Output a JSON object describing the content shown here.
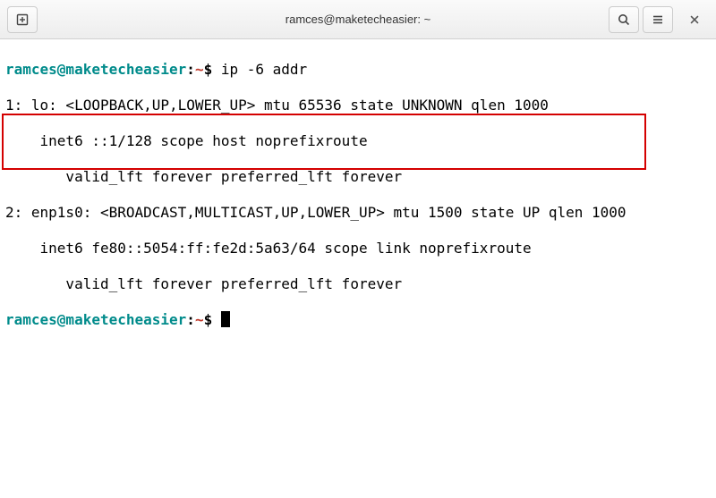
{
  "titlebar": {
    "title": "ramces@maketecheasier: ~"
  },
  "prompt": {
    "user": "ramces@maketecheasier",
    "sep": ":",
    "path": "~",
    "dollar": "$"
  },
  "lines": {
    "cmd1": "ip -6 addr",
    "out1": "1: lo: <LOOPBACK,UP,LOWER_UP> mtu 65536 state UNKNOWN qlen 1000",
    "out2": "    inet6 ::1/128 scope host noprefixroute",
    "out3": "       valid_lft forever preferred_lft forever",
    "out4": "2: enp1s0: <BROADCAST,MULTICAST,UP,LOWER_UP> mtu 1500 state UP qlen 1000",
    "out5": "    inet6 fe80::5054:ff:fe2d:5a63/64 scope link noprefixroute",
    "out6": "       valid_lft forever preferred_lft forever"
  },
  "icons": {
    "newtab": "new-tab-icon",
    "search": "search-icon",
    "menu": "hamburger-icon",
    "close": "close-icon"
  }
}
